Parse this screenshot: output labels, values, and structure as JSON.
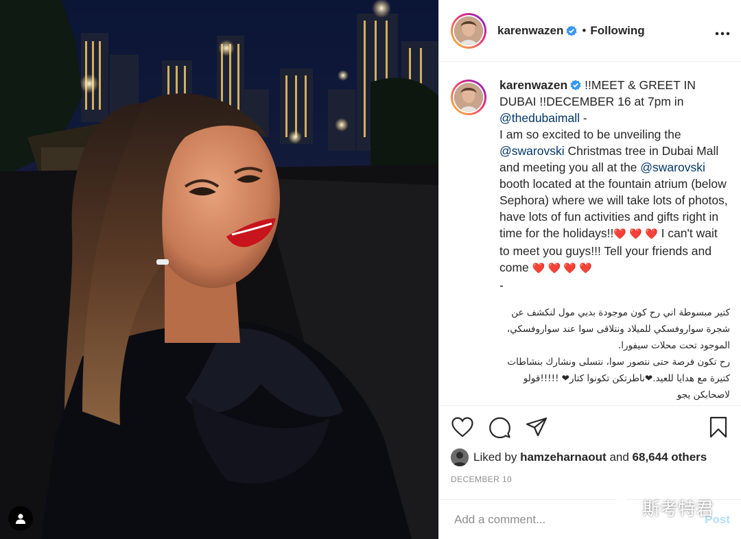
{
  "header": {
    "username": "karenwazen",
    "separator": "•",
    "follow_status": "Following",
    "more_icon": "ellipsis-icon"
  },
  "caption": {
    "username": "karenwazen",
    "line1": "!!MEET & GREET IN DUBAI !!DECEMBER 16 at 7pm in",
    "mention1": "@thedubaimall",
    "dash1": " -",
    "text2": "I am so excited to be unveiling the",
    "mention2": "@swarovski",
    "text3": " Christmas tree in Dubai Mall and meeting you all at the ",
    "mention3": "@swarovski",
    "text4": " booth located at the fountain atrium (below Sephora) where we will take lots of photos, have lots of fun activities and gifts right in time for the holidays!!",
    "hearts_a": "❤️ ❤️ ❤️",
    "text5": "  I can't wait to meet you guys!!! Tell your friends and come ",
    "hearts_b": "❤️ ❤️ ❤️ ❤️",
    "dash2": "-",
    "arabic1": "كتير مبسوطة اني رح كون موجودة بدبي مول لنكشف عن شجرة سواروفسكي للميلاد ونتلاقى سوا عند سواروفسكي، الموجود تحت محلات سيفورا.",
    "arabic2": "رح تكون فرصة حتى نتصور سوا، نتسلى ونشارك بنشاطات كتيرة مع هدايا للعيد.❤ناطرتكن تكونوا كتار❤ !!!!!قولو لاصحابكن يجو"
  },
  "actions": {
    "like_icon": "heart-icon",
    "comment_icon": "comment-icon",
    "share_icon": "share-icon",
    "save_icon": "bookmark-icon"
  },
  "likes": {
    "prefix": "Liked by",
    "user": "hamzeharnaout",
    "and": "and",
    "count": "68,644 others"
  },
  "date": "DECEMBER 10",
  "comment": {
    "placeholder": "Add a comment...",
    "post_label": "Post"
  },
  "watermark": {
    "text": "斯考特君"
  },
  "colors": {
    "verified": "#3897f0",
    "mention": "#00376b",
    "post_disabled": "#b2dffc",
    "heart": "#e0141e"
  }
}
